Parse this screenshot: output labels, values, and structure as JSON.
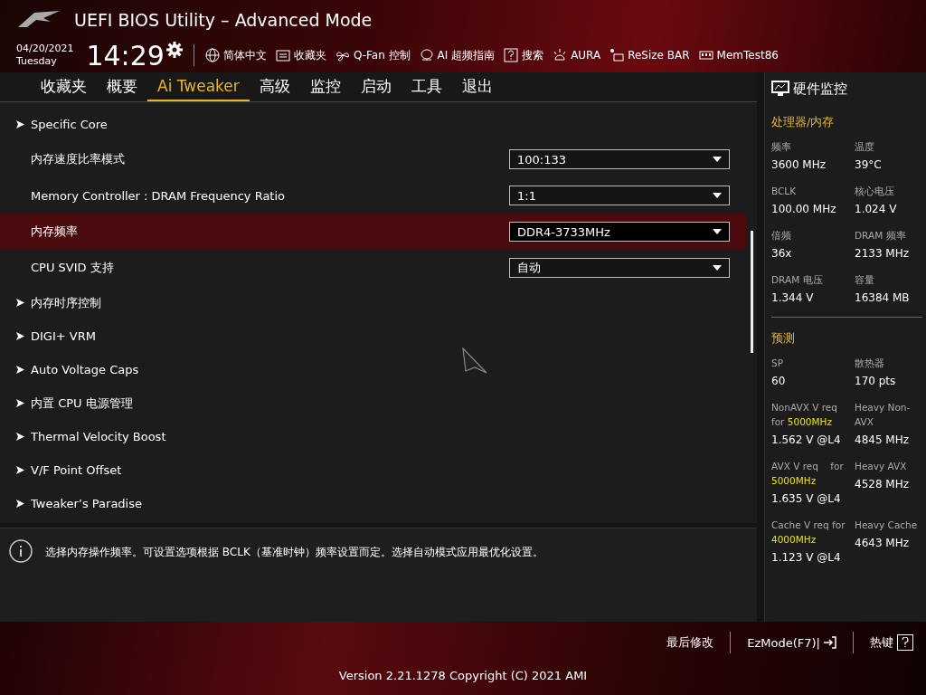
{
  "window": {
    "title": "UEFI BIOS Utility – Advanced Mode"
  },
  "clock": {
    "date": "04/20/2021",
    "weekday": "Tuesday",
    "time": "14:29"
  },
  "toolbar": [
    {
      "kind": "globe",
      "label": "简体中文"
    },
    {
      "kind": "folder",
      "label": "收藏夹"
    },
    {
      "kind": "fan",
      "label": "Q-Fan 控制"
    },
    {
      "kind": "chip",
      "label": "AI 超频指南"
    },
    {
      "kind": "help",
      "label": "搜索"
    },
    {
      "kind": "aura",
      "label": "AURA"
    },
    {
      "kind": "resize",
      "label": "ReSize BAR"
    },
    {
      "kind": "memory",
      "label": "MemTest86"
    }
  ],
  "tabs": [
    {
      "label": "收藏夹",
      "selected": false
    },
    {
      "label": "概要",
      "selected": false
    },
    {
      "label": "Ai Tweaker",
      "selected": true
    },
    {
      "label": "高级",
      "selected": false
    },
    {
      "label": "监控",
      "selected": false
    },
    {
      "label": "启动",
      "selected": false
    },
    {
      "label": "工具",
      "selected": false
    },
    {
      "label": "退出",
      "selected": false
    }
  ],
  "settings": [
    {
      "kind": "submenu",
      "label": "Specific Core",
      "selected": false
    },
    {
      "kind": "select",
      "label": "内存速度比率模式",
      "value": "100:133",
      "selected": false
    },
    {
      "kind": "select",
      "label": "Memory Controller : DRAM Frequency Ratio",
      "value": "1:1",
      "selected": false
    },
    {
      "kind": "select",
      "label": "内存频率",
      "value": "DDR4-3733MHz",
      "selected": true
    },
    {
      "kind": "select",
      "label": "CPU SVID 支持",
      "value": "自动",
      "selected": false
    },
    {
      "kind": "submenu",
      "label": "内存时序控制",
      "selected": false
    },
    {
      "kind": "submenu",
      "label": "DIGI+ VRM",
      "selected": false
    },
    {
      "kind": "submenu",
      "label": "Auto Voltage Caps",
      "selected": false
    },
    {
      "kind": "submenu",
      "label": "内置 CPU 电源管理",
      "selected": false
    },
    {
      "kind": "submenu",
      "label": "Thermal Velocity Boost",
      "selected": false
    },
    {
      "kind": "submenu",
      "label": "V/F Point Offset",
      "selected": false
    },
    {
      "kind": "submenu",
      "label": "Tweaker’s Paradise",
      "selected": false
    }
  ],
  "help_text": "选择内存操作频率。可设置选项根据 BCLK（基准时钟）频率设置而定。选择自动模式应用最优化设置。",
  "monitor": {
    "title": "硬件监控",
    "sections": [
      {
        "title": "处理器/内存",
        "items": [
          {
            "label": "频率",
            "value": "3600 MHz"
          },
          {
            "label": "温度",
            "value": "39°C"
          },
          {
            "label": "BCLK",
            "value": "100.00 MHz"
          },
          {
            "label": "核心电压",
            "value": "1.024 V"
          },
          {
            "label": "倍频",
            "value": "36x"
          },
          {
            "label": "DRAM 频率",
            "value": "2133 MHz"
          },
          {
            "label": "DRAM 电压",
            "value": "1.344 V"
          },
          {
            "label": "容量",
            "value": "16384 MB"
          }
        ]
      },
      {
        "title": "预测",
        "items": [
          {
            "label": "SP",
            "value": "60"
          },
          {
            "label": "散热器",
            "value": "170 pts"
          },
          {
            "label": "NonAVX V req for **5000MHz**",
            "value": "1.562 V @L4"
          },
          {
            "label": "Heavy Non-AVX",
            "value": "4845 MHz"
          },
          {
            "label": "AVX V req    for **5000MHz**",
            "value": "1.635 V @L4"
          },
          {
            "label": "Heavy AVX",
            "value": "4528 MHz"
          },
          {
            "label": "Cache V req for **4000MHz**",
            "value": "1.123 V @L4"
          },
          {
            "label": "Heavy Cache",
            "value": "4643 MHz"
          }
        ]
      }
    ]
  },
  "footer": {
    "links": [
      {
        "kind": "plain",
        "label": "最后修改"
      },
      {
        "kind": "exit",
        "label": "EzMode(F7)|"
      },
      {
        "kind": "help",
        "label": "热键"
      }
    ],
    "version": "Version 2.21.1278 Copyright (C) 2021 AMI"
  }
}
